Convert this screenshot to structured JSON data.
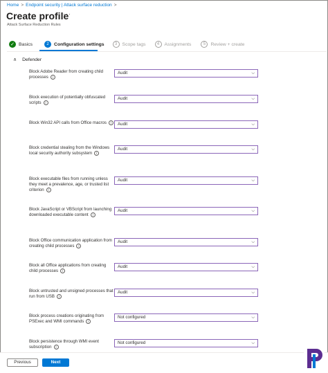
{
  "breadcrumb": {
    "items": [
      "Home",
      "Endpoint security | Attack surface reduction"
    ],
    "separator": ">"
  },
  "header": {
    "title": "Create profile",
    "more": "···",
    "subtitle": "Attack Surface Reduction Rules"
  },
  "wizard": {
    "steps": [
      {
        "label": "Basics",
        "marker": "✓",
        "state": "done"
      },
      {
        "label": "Configuration settings",
        "marker": "2",
        "state": "active"
      },
      {
        "label": "Scope tags",
        "marker": "3",
        "state": "pending"
      },
      {
        "label": "Assignments",
        "marker": "4",
        "state": "pending"
      },
      {
        "label": "Review + create",
        "marker": "5",
        "state": "pending"
      }
    ]
  },
  "section": {
    "title": "Defender",
    "chevron": "∧"
  },
  "settings": [
    {
      "label": "Block Adobe Reader from creating child processes",
      "value": "Audit"
    },
    {
      "label": "Block execution of potentially obfuscated scripts",
      "value": "Audit"
    },
    {
      "label": "Block Win32 API calls from Office macros",
      "value": "Audit"
    },
    {
      "label": "Block credential stealing from the Windows local security authority subsystem",
      "value": "Audit"
    },
    {
      "label": "Block executable files from running unless they meet a prevalence, age, or trusted list criterion",
      "value": "Audit"
    },
    {
      "label": "Block JavaScript or VBScript from launching downloaded executable content",
      "value": "Audit"
    },
    {
      "label": "Block Office communication application from creating child processes",
      "value": "Audit"
    },
    {
      "label": "Block all Office applications from creating child processes",
      "value": "Audit"
    },
    {
      "label": "Block untrusted and unsigned processes that run from USB",
      "value": "Audit"
    },
    {
      "label": "Block process creations originating from PSExec and WMI commands",
      "value": "Not configured"
    },
    {
      "label": "Block persistence through WMI event subscription",
      "value": "Not configured"
    }
  ],
  "footer": {
    "previous_label": "Previous",
    "next_label": "Next"
  },
  "colors": {
    "accent": "#0078d4",
    "done": "#107c10",
    "select_border": "#8a65b8",
    "logo": "#5c2d91"
  },
  "icons": {
    "info": "info-icon",
    "dropdown": "chevron-down-icon",
    "done": "checkmark-icon",
    "logo": "logo-icon"
  }
}
